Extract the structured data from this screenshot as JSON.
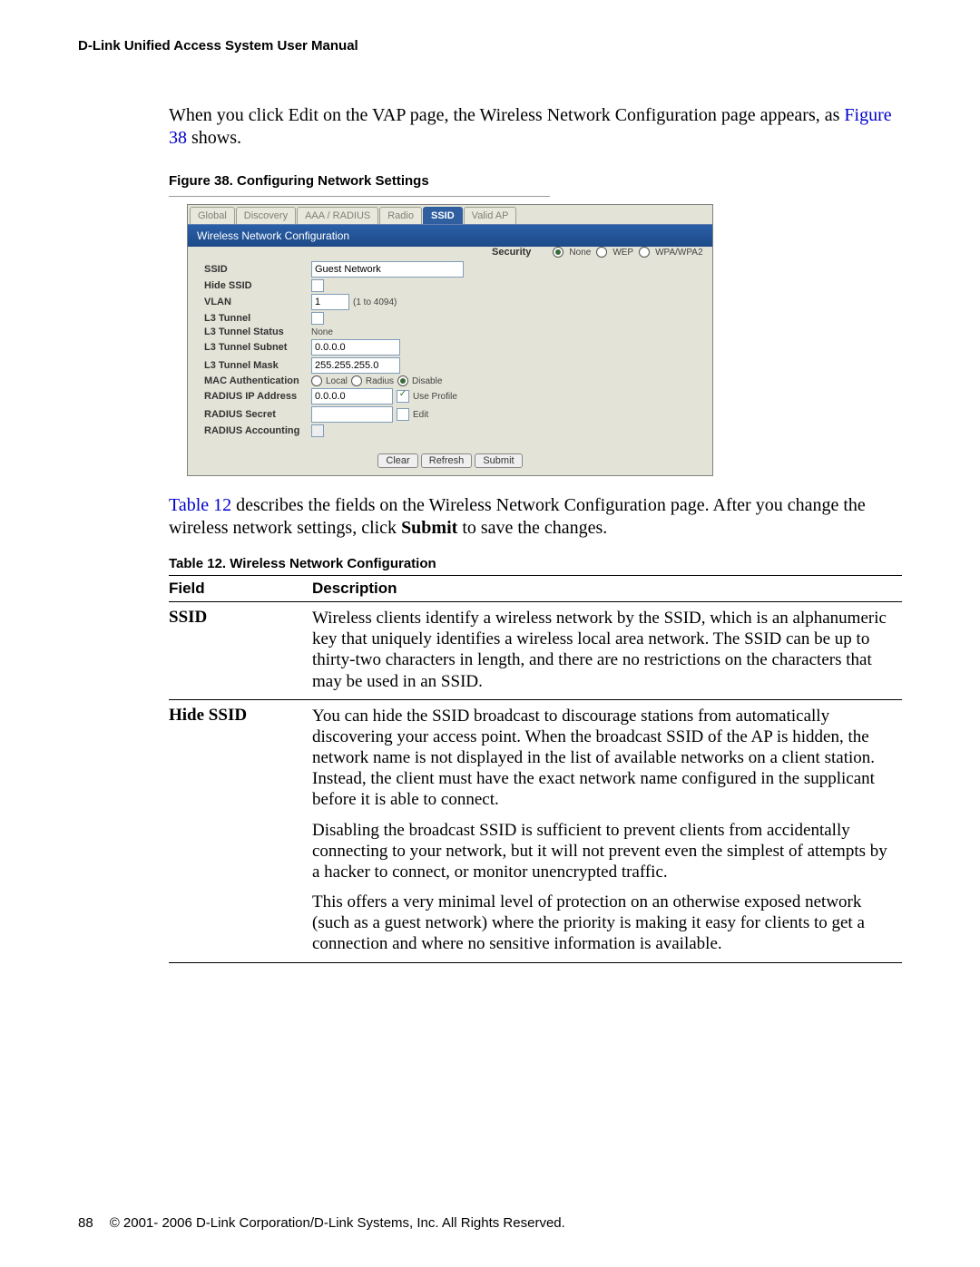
{
  "header": {
    "text": "D-Link Unified Access System User Manual"
  },
  "intro": {
    "pre_link": "When you click Edit on the VAP page, the Wireless Network Configuration page appears, as ",
    "link": "Figure 38",
    "post_link": " shows."
  },
  "figure": {
    "caption": "Figure 38.  Configuring Network Settings",
    "tabs": [
      "Global",
      "Discovery",
      "AAA / RADIUS",
      "Radio",
      "SSID",
      "Valid AP"
    ],
    "active_tab": "SSID",
    "titlebar": "Wireless Network Configuration",
    "rows": {
      "ssid": {
        "label": "SSID",
        "value": "Guest Network"
      },
      "security": {
        "label": "Security",
        "options": [
          "None",
          "WEP",
          "WPA/WPA2"
        ],
        "selected": "None"
      },
      "hide_ssid": {
        "label": "Hide SSID",
        "checked": false
      },
      "vlan": {
        "label": "VLAN",
        "value": "1",
        "hint": "(1 to 4094)"
      },
      "l3_tunnel": {
        "label": "L3 Tunnel",
        "checked": false
      },
      "l3_tunnel_status": {
        "label": "L3 Tunnel Status",
        "value": "None"
      },
      "l3_tunnel_subnet": {
        "label": "L3 Tunnel Subnet",
        "value": "0.0.0.0"
      },
      "l3_tunnel_mask": {
        "label": "L3 Tunnel Mask",
        "value": "255.255.255.0"
      },
      "mac_auth": {
        "label": "MAC Authentication",
        "options": [
          "Local",
          "Radius",
          "Disable"
        ],
        "selected": "Disable"
      },
      "radius_ip": {
        "label": "RADIUS IP Address",
        "value": "0.0.0.0",
        "use_profile_label": "Use Profile",
        "use_profile_checked": true
      },
      "radius_secret": {
        "label": "RADIUS Secret",
        "value": "",
        "edit_label": "Edit",
        "edit_checked": false
      },
      "radius_acct": {
        "label": "RADIUS Accounting",
        "checked": false,
        "disabled": true
      }
    },
    "buttons": [
      "Clear",
      "Refresh",
      "Submit"
    ]
  },
  "post_fig": {
    "link": "Table 12",
    "pre": " describes the fields on the Wireless Network Configuration page. After you change the wireless network settings, click ",
    "strong": "Submit",
    "tail": " to save the changes."
  },
  "table": {
    "caption": "Table 12.  Wireless Network Configuration",
    "head": {
      "field": "Field",
      "desc": "Description"
    },
    "rows": [
      {
        "field": "SSID",
        "paras": [
          "Wireless clients identify a wireless network by the SSID, which is an alphanumeric key that uniquely identifies a wireless local area network. The SSID can be up to thirty-two characters in length, and there are no restrictions on the characters that may be used in an SSID."
        ]
      },
      {
        "field": "Hide SSID",
        "paras": [
          "You can hide the SSID broadcast to discourage stations from automatically discovering your access point. When the broadcast SSID of the AP is hidden, the network name is not displayed in the list of available networks on a client station. Instead, the client must have the exact network name configured in the supplicant before it is able to connect.",
          "Disabling the broadcast SSID is sufficient to prevent clients from accidentally connecting to your network, but it will not prevent even the simplest of attempts by a hacker to connect, or monitor unencrypted traffic.",
          "This offers a very minimal level of protection on an otherwise exposed network (such as a guest network) where the priority is making it easy for clients to get a connection and where no sensitive information is available."
        ]
      }
    ]
  },
  "footer": {
    "page": "88",
    "copyright": "© 2001- 2006 D-Link Corporation/D-Link Systems, Inc. All Rights Reserved."
  }
}
